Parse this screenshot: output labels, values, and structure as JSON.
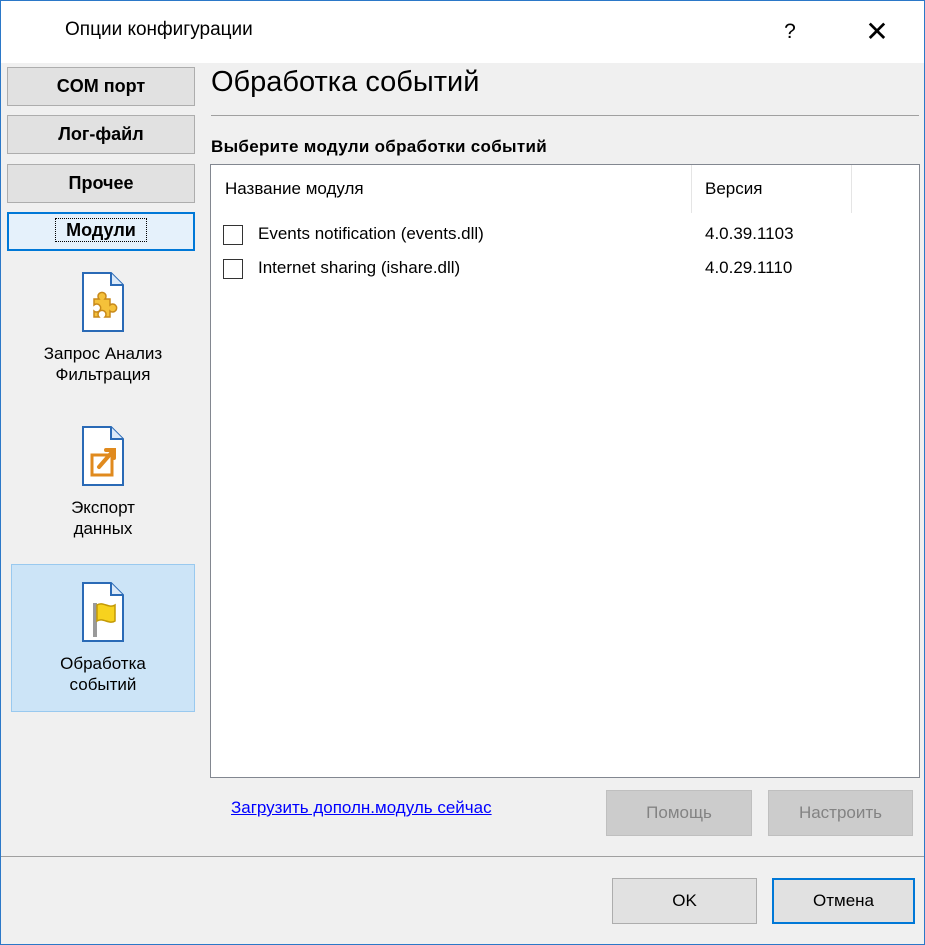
{
  "window": {
    "title": "Опции конфигурации",
    "help_label": "?",
    "close_label": "✕"
  },
  "nav": {
    "buttons": [
      {
        "label": "COM порт"
      },
      {
        "label": "Лог-файл"
      },
      {
        "label": "Прочее"
      },
      {
        "label": "Модули"
      }
    ],
    "active_index": 3,
    "modules": [
      {
        "label_line1": "Запрос Анализ",
        "label_line2": "Фильтрация",
        "icon": "puzzle-icon"
      },
      {
        "label_line1": "Экспорт",
        "label_line2": "данных",
        "icon": "export-icon"
      },
      {
        "label_line1": "Обработка",
        "label_line2": "событий",
        "icon": "flag-icon"
      }
    ],
    "selected_module_index": 2
  },
  "main": {
    "heading": "Обработка событий",
    "subheading": "Выберите модули обработки событий",
    "columns": [
      "Название модуля",
      "Версия"
    ],
    "rows": [
      {
        "checked": false,
        "name": "Events notification (events.dll)",
        "version": "4.0.39.1103"
      },
      {
        "checked": false,
        "name": "Internet sharing (ishare.dll)",
        "version": "4.0.29.1110"
      }
    ],
    "link_label": "Загрузить дополн.модуль сейчас",
    "help_button": "Помощь",
    "setup_button": "Настроить"
  },
  "footer": {
    "ok_label": "OK",
    "cancel_label": "Отмена"
  },
  "colors": {
    "accent": "#0078d7",
    "window_border": "#2b78c8",
    "link": "#0000ff",
    "selection": "#cce4f7"
  }
}
